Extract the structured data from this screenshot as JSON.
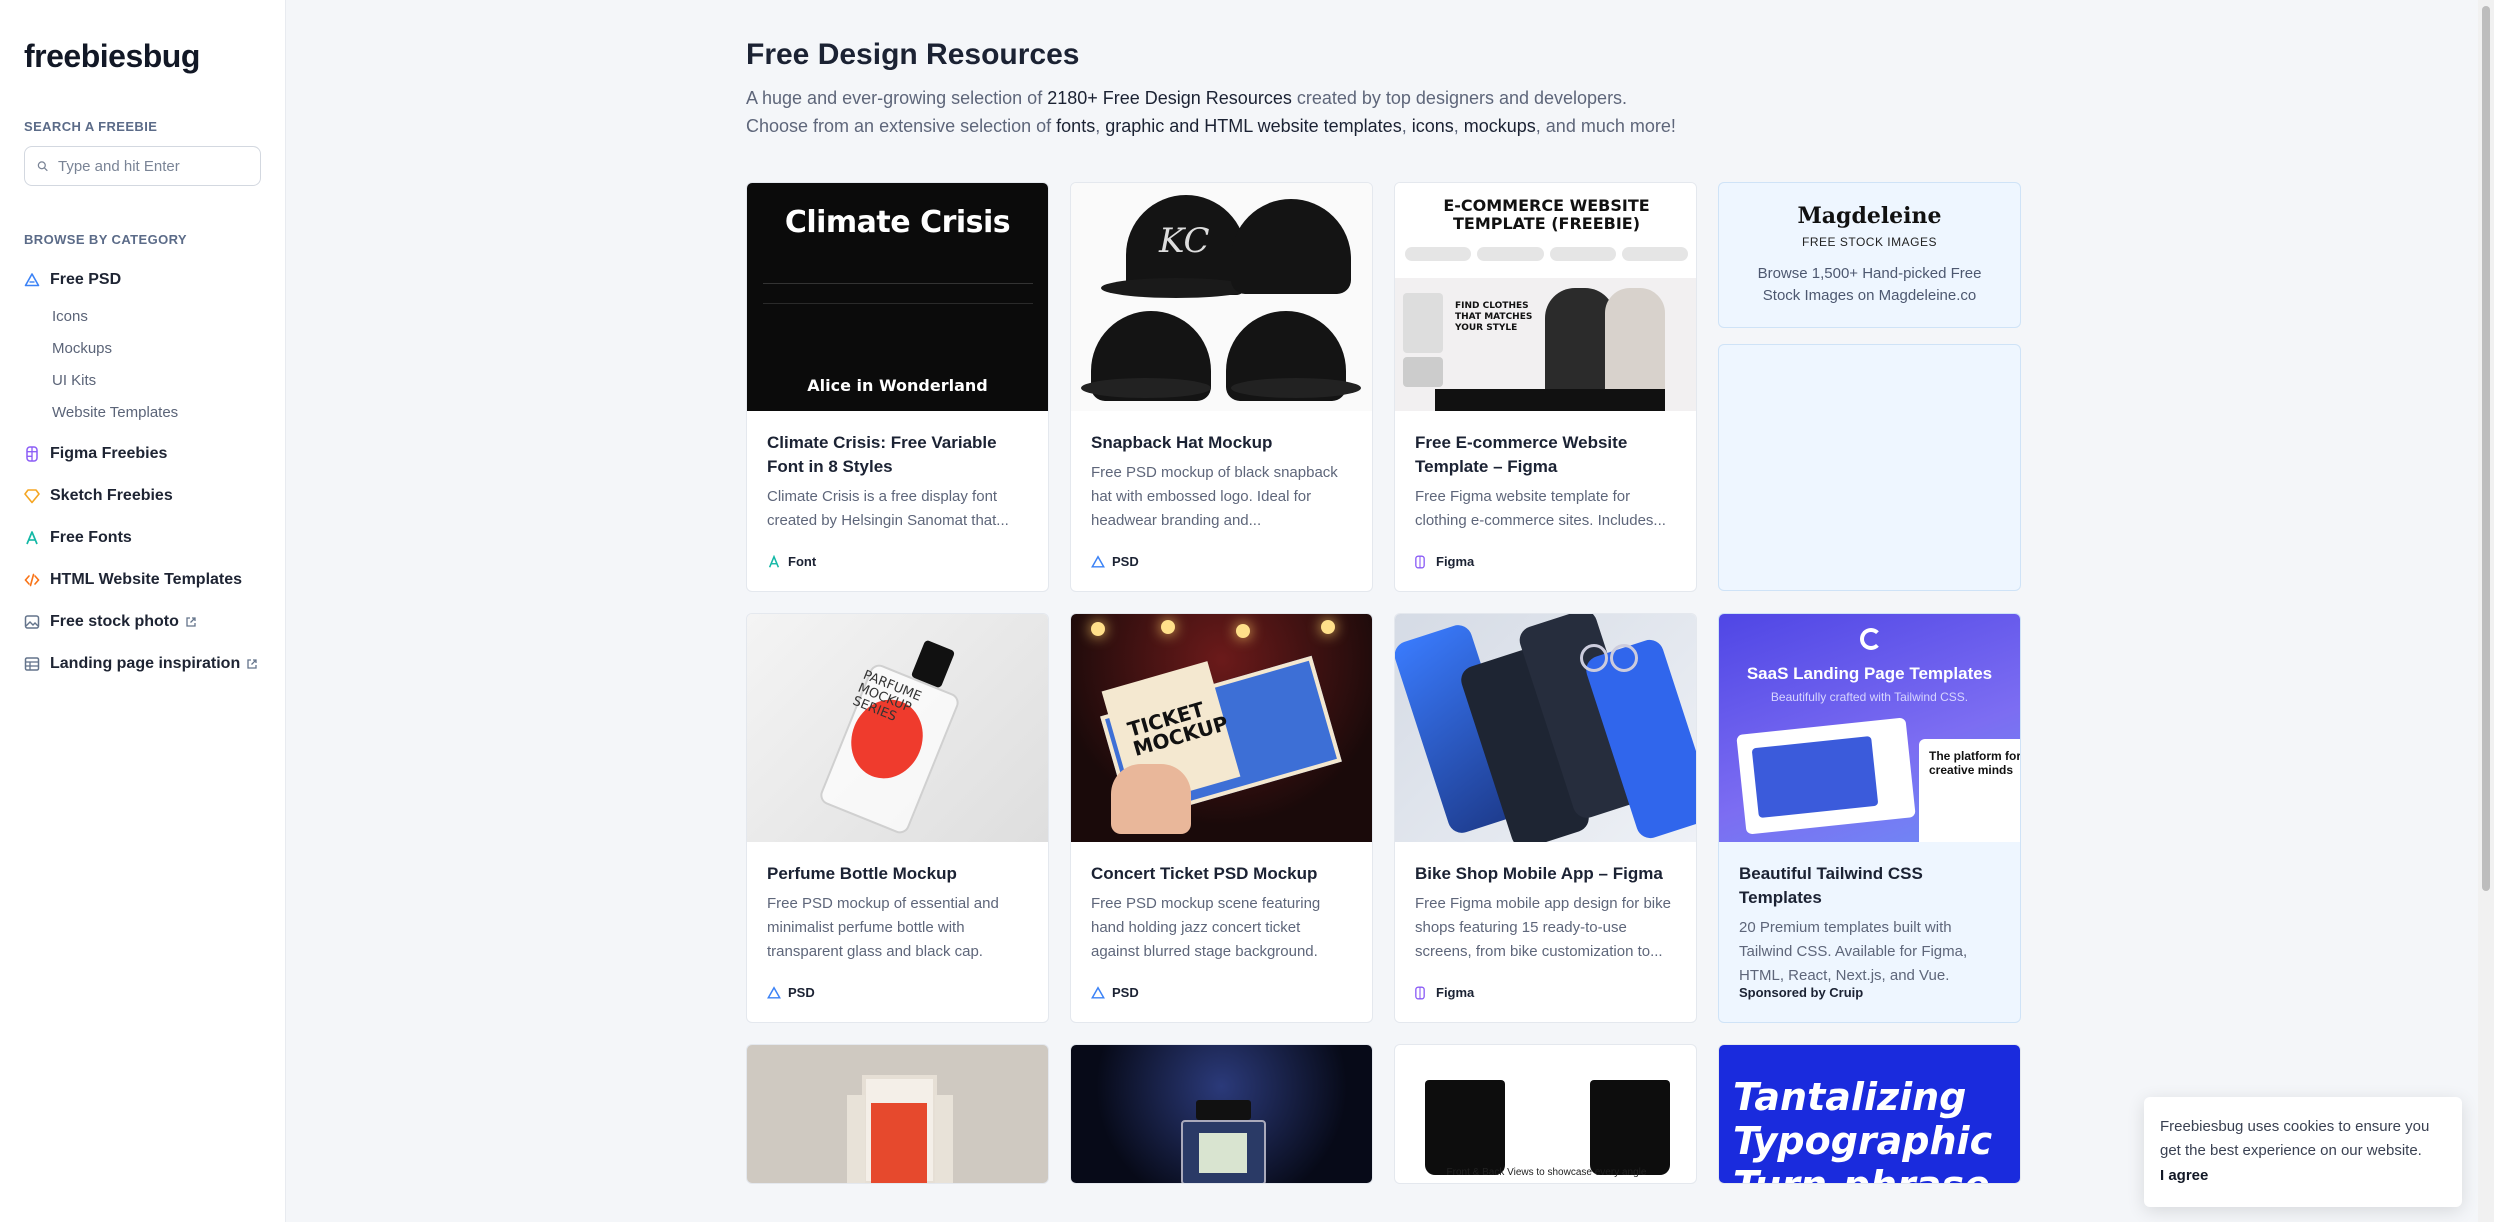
{
  "brand": {
    "logo": "freebiesbug"
  },
  "sidebar": {
    "search_title": "SEARCH A FREEBIE",
    "search_placeholder": "Type and hit Enter",
    "browse_title": "BROWSE BY CATEGORY",
    "items": [
      {
        "label": "Free PSD",
        "icon": "psd-icon",
        "color": "#3b82f6"
      },
      {
        "label": "Figma Freebies",
        "icon": "figma-icon",
        "color": "#8b5cf6"
      },
      {
        "label": "Sketch Freebies",
        "icon": "sketch-icon",
        "color": "#f5a623"
      },
      {
        "label": "Free Fonts",
        "icon": "font-icon",
        "color": "#14b8a6"
      },
      {
        "label": "HTML Website Templates",
        "icon": "code-icon",
        "color": "#f97316"
      },
      {
        "label": "Free stock photo",
        "icon": "image-icon",
        "color": "#64748b"
      },
      {
        "label": "Landing page inspiration",
        "icon": "layout-icon",
        "color": "#64748b"
      }
    ],
    "psd_sub": [
      "Icons",
      "Mockups",
      "UI Kits",
      "Website Templates"
    ]
  },
  "main": {
    "title": "Free Design Resources",
    "intro": {
      "a": "A huge and ever-growing selection of ",
      "b": "2180+ Free Design Resources",
      "c": " created by top designers and developers.",
      "d": "Choose from an extensive selection of ",
      "e": "fonts",
      "f": ", ",
      "g": "graphic and HTML website templates",
      "h": ", ",
      "i": "icons",
      "j": ", ",
      "k": "mockups",
      "l": ", and much more!"
    }
  },
  "cards": [
    {
      "title": "Climate Crisis: Free Variable Font in 8 Styles",
      "desc": "Climate Crisis is a free display font created by Helsingin Sanomat that...",
      "tag": "Font",
      "thumb_text": "Climate Crisis",
      "thumb_sub": "Alice in Wonderland"
    },
    {
      "title": "Snapback Hat Mockup",
      "desc": "Free PSD mockup of black snapback hat with embossed logo. Ideal for headwear branding and...",
      "tag": "PSD"
    },
    {
      "title": "Free E-commerce Website Template – Figma",
      "desc": "Free Figma website template for clothing e-commerce sites. Includes...",
      "tag": "Figma",
      "thumb_text": "E-COMMERCE WEBSITE TEMPLATE (FREEBIE)",
      "thumb_sub": "FIND CLOTHES THAT MATCHES YOUR STYLE"
    },
    {
      "title": "Perfume Bottle Mockup",
      "desc": "Free PSD mockup of essential and minimalist perfume bottle with transparent glass and black cap.",
      "tag": "PSD",
      "thumb_text": "PARFUME MOCKUP SERIES"
    },
    {
      "title": "Concert Ticket PSD Mockup",
      "desc": "Free PSD mockup scene featuring hand holding jazz concert ticket against blurred stage background.",
      "tag": "PSD",
      "thumb_text": "TICKET MOCKUP"
    },
    {
      "title": "Bike Shop Mobile App – Figma",
      "desc": "Free Figma mobile app design for bike shops featuring 15 ready-to-use screens, from bike customization to...",
      "tag": "Figma"
    },
    {
      "title": "Beautiful Tailwind CSS Templates",
      "desc": "20 Premium templates built with Tailwind CSS. Available for Figma, HTML, React, Next.js, and Vue.",
      "tag": "Sponsored by Cruip",
      "thumb_text": "SaaS Landing Page Templates",
      "thumb_sub": "Beautifully crafted with Tailwind CSS.",
      "thumb_side": "The platform for creative minds"
    }
  ],
  "row3": [
    {
      "thumb_text": ""
    },
    {
      "thumb_text": ""
    },
    {
      "thumb_text": "Front & Back Views to showcase every angle"
    },
    {
      "thumb_text": "Tantalizing Typographic Turn-phrase"
    }
  ],
  "ad": {
    "name": "Magdeleine",
    "sub": "FREE STOCK IMAGES",
    "text": "Browse 1,500+ Hand-picked Free Stock Images on Magdeleine.co"
  },
  "cookie": {
    "text": "Freebiesbug uses cookies to ensure you get the best experience on our website.",
    "button": "I agree"
  }
}
